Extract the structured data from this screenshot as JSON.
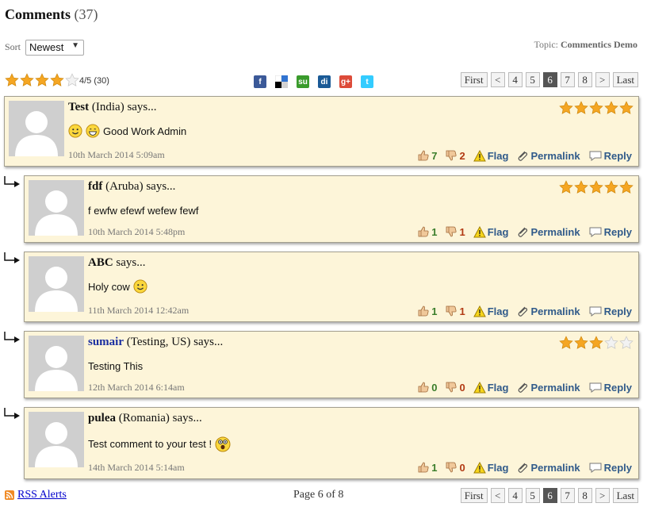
{
  "header": {
    "title": "Comments",
    "count": "(37)"
  },
  "sort": {
    "label": "Sort",
    "selected": "Newest"
  },
  "topic": {
    "label": "Topic:",
    "value": "Commentics Demo"
  },
  "average_rating": {
    "value": 4,
    "max": 5,
    "text": "4/5 (30)"
  },
  "share_icons": [
    "facebook-icon",
    "delicious-icon",
    "stumbleupon-icon",
    "digg-icon",
    "google-plus-icon",
    "twitter-icon"
  ],
  "pagination": {
    "first": "First",
    "prev": "<",
    "pages": [
      "4",
      "5",
      "6",
      "7",
      "8"
    ],
    "current": "6",
    "next": ">",
    "last": "Last"
  },
  "comments": [
    {
      "name": "Test",
      "location": "(India)",
      "says": "says...",
      "text": "Good Work Admin",
      "emoji": [
        "smile-emoji",
        "grin-emoji"
      ],
      "date": "10th March 2014 5:09am",
      "rating": 5,
      "likes": "7",
      "dislikes": "2",
      "is_reply": false,
      "name_link": false
    },
    {
      "name": "fdf",
      "location": "(Aruba)",
      "says": "says...",
      "text": "f ewfw efewf wefew fewf",
      "emoji": [],
      "date": "10th March 2014 5:48pm",
      "rating": 5,
      "likes": "1",
      "dislikes": "1",
      "is_reply": true,
      "name_link": false
    },
    {
      "name": "ABC",
      "location": "",
      "says": "says...",
      "text": "Holy cow",
      "emoji_after": [
        "smile-emoji"
      ],
      "date": "11th March 2014 12:42am",
      "rating": 0,
      "likes": "1",
      "dislikes": "1",
      "is_reply": true,
      "name_link": false
    },
    {
      "name": "sumair",
      "location": "(Testing, US)",
      "says": "says...",
      "text": "Testing This",
      "emoji": [],
      "date": "12th March 2014 6:14am",
      "rating": 3,
      "likes": "0",
      "dislikes": "0",
      "is_reply": true,
      "name_link": true
    },
    {
      "name": "pulea",
      "location": "(Romania)",
      "says": "says...",
      "text": "Test comment to your test !",
      "emoji_after": [
        "shocked-emoji"
      ],
      "date": "14th March 2014 5:14am",
      "rating": 0,
      "likes": "1",
      "dislikes": "0",
      "is_reply": true,
      "name_link": false
    }
  ],
  "actions": {
    "flag": "Flag",
    "permalink": "Permalink",
    "reply": "Reply"
  },
  "footer": {
    "rss": "RSS Alerts",
    "page_status": "Page 6 of 8"
  },
  "colors": {
    "comment_bg": "#fdf5d9",
    "star": "#f5a623",
    "like": "#3a7d2a",
    "dislike": "#b23a14",
    "action_blue": "#305a8a"
  }
}
